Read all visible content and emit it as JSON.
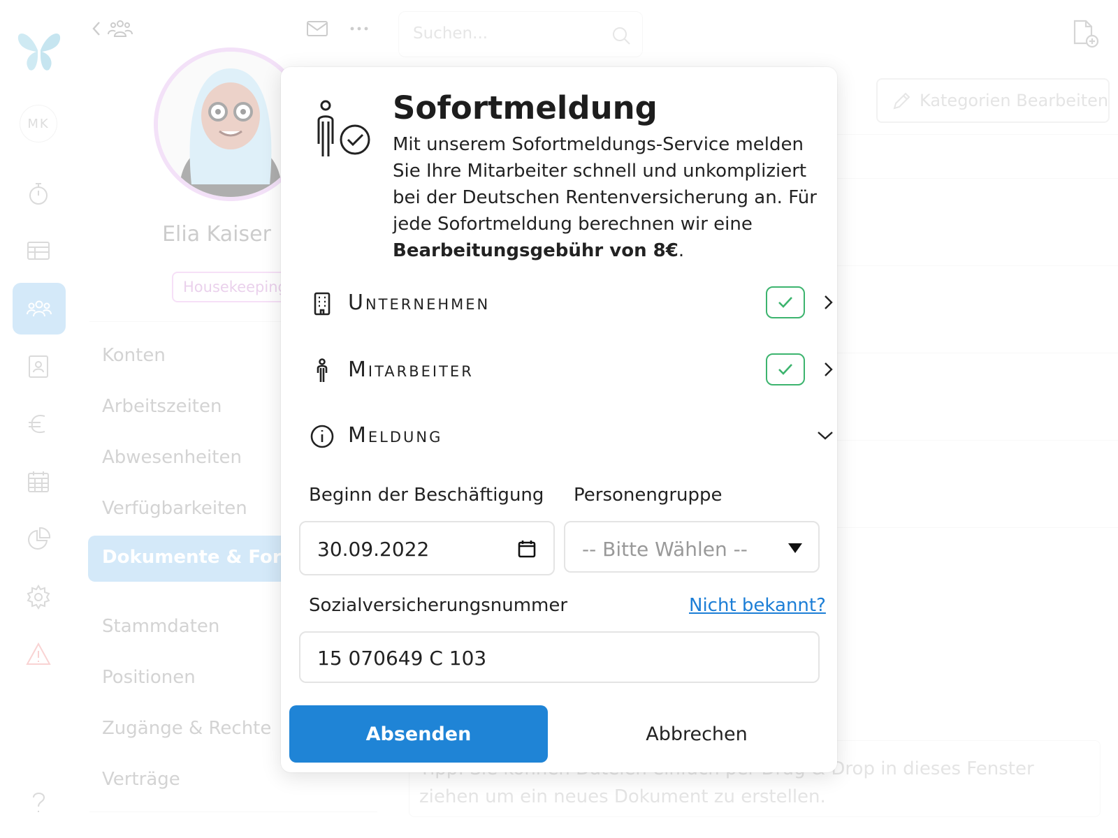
{
  "sidebar": {
    "user_initials": "MK",
    "items": [
      {
        "icon": "stopwatch-icon"
      },
      {
        "icon": "table-icon"
      },
      {
        "icon": "employees-icon",
        "active": true
      },
      {
        "icon": "contact-card-icon"
      },
      {
        "icon": "euro-icon"
      },
      {
        "icon": "calendar-icon"
      },
      {
        "icon": "pie-chart-icon"
      },
      {
        "icon": "gear-icon"
      },
      {
        "icon": "warning-icon"
      },
      {
        "icon": "help-icon"
      }
    ]
  },
  "profile": {
    "name": "Elia Kaiser",
    "tag": "Housekeeping",
    "nav": [
      "Konten",
      "Arbeitszeiten",
      "Abwesenheiten",
      "Verfügbarkeiten",
      "Dokumente & Formu",
      "Stammdaten",
      "Positionen",
      "Zugänge & Rechte",
      "Verträge"
    ],
    "active_nav": "Dokumente & Formu"
  },
  "search": {
    "placeholder": "Suchen..."
  },
  "main": {
    "edit_categories_label": "Kategorien Bearbeiten",
    "drop_hint": "Tipp: Sie können Dateien einfach per Drag & Drop in dieses Fenster ziehen um ein neues Dokument zu erstellen."
  },
  "modal": {
    "title": "Sofortmeldung",
    "description": "Mit unserem Sofortmeldungs-Service melden Sie Ihre Mitarbeiter schnell und unkompliziert bei der Deutschen Rentenversicherung an. Für jede Sofortmeldung berechnen wir eine",
    "fee_bold": "Bearbeitungsgebühr von 8€",
    "fee_suffix": ".",
    "sections": {
      "company": {
        "label": "Unternehmen",
        "complete": true
      },
      "employee": {
        "label": "Mitarbeiter",
        "complete": true
      },
      "report": {
        "label": "Meldung",
        "expanded": true
      }
    },
    "fields": {
      "start_label": "Beginn der Beschäftigung",
      "start_value": "30.09.2022",
      "group_label": "Personengruppe",
      "group_placeholder": "-- Bitte Wählen --",
      "ssn_label": "Sozialversicherungsnummer",
      "ssn_help_link": "Nicht bekannt?",
      "ssn_value": "15 070649 C 103"
    },
    "submit_label": "Absenden",
    "cancel_label": "Abbrechen"
  },
  "colors": {
    "primary": "#1f84d6",
    "sidebar_active": "#a9d3f2",
    "success": "#3cb46e",
    "link": "#1c7ed6",
    "tag_border": "#ecc1ee"
  }
}
